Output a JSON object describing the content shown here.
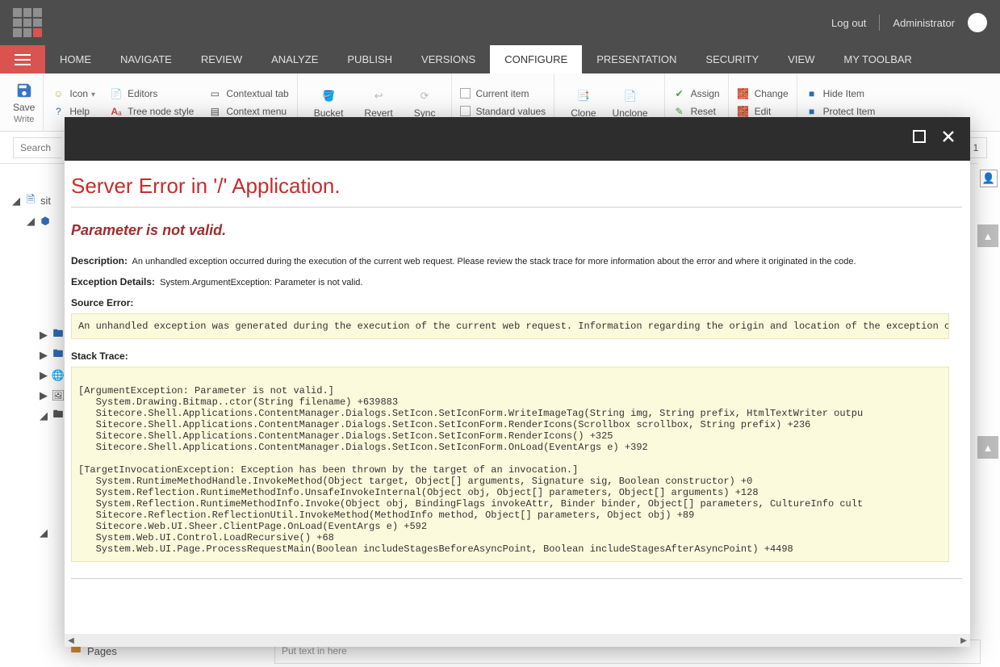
{
  "topbar": {
    "logout": "Log out",
    "user": "Administrator"
  },
  "nav": {
    "tabs": [
      "HOME",
      "NAVIGATE",
      "REVIEW",
      "ANALYZE",
      "PUBLISH",
      "VERSIONS",
      "CONFIGURE",
      "PRESENTATION",
      "SECURITY",
      "VIEW",
      "MY TOOLBAR"
    ],
    "active_index": 6
  },
  "ribbon": {
    "save": {
      "label": "Save",
      "sublabel": "Write"
    },
    "group1": {
      "icon_label": "Icon",
      "help": "Help",
      "editors": "Editors",
      "tree_node_style": "Tree node style",
      "contextual_tab": "Contextual tab",
      "context_menu": "Context menu"
    },
    "group2": {
      "bucket": "Bucket",
      "revert": "Revert",
      "sync": "Sync"
    },
    "group3": {
      "current_item": "Current item",
      "standard_values": "Standard values"
    },
    "group4": {
      "clone": "Clone",
      "unclone": "Unclone"
    },
    "group5": {
      "assign": "Assign",
      "reset": "Reset"
    },
    "group6": {
      "change": "Change",
      "edit": "Edit"
    },
    "group7": {
      "hide": "Hide Item",
      "protect": "Protect Item"
    }
  },
  "search": {
    "placeholder": "Search",
    "counter": "1"
  },
  "tree": {
    "root": "sit",
    "pages": "Pages"
  },
  "bottom": {
    "input_placeholder": "Put text in here"
  },
  "error": {
    "title": "Server Error in '/' Application.",
    "subtitle": "Parameter is not valid.",
    "description_label": "Description:",
    "description_text": "An unhandled exception occurred during the execution of the current web request. Please review the stack trace for more information about the error and where it originated in the code.",
    "exception_label": "Exception Details:",
    "exception_text": "System.ArgumentException: Parameter is not valid.",
    "source_error_label": "Source Error:",
    "source_error_text": "An unhandled exception was generated during the execution of the current web request. Information regarding the origin and location of the exception can be identified using the exception stack trace below.",
    "stack_trace_label": "Stack Trace:",
    "stack_trace_text": "\n[ArgumentException: Parameter is not valid.]\n   System.Drawing.Bitmap..ctor(String filename) +639883\n   Sitecore.Shell.Applications.ContentManager.Dialogs.SetIcon.SetIconForm.WriteImageTag(String img, String prefix, HtmlTextWriter outpu\n   Sitecore.Shell.Applications.ContentManager.Dialogs.SetIcon.SetIconForm.RenderIcons(Scrollbox scrollbox, String prefix) +236\n   Sitecore.Shell.Applications.ContentManager.Dialogs.SetIcon.SetIconForm.RenderIcons() +325\n   Sitecore.Shell.Applications.ContentManager.Dialogs.SetIcon.SetIconForm.OnLoad(EventArgs e) +392\n\n[TargetInvocationException: Exception has been thrown by the target of an invocation.]\n   System.RuntimeMethodHandle.InvokeMethod(Object target, Object[] arguments, Signature sig, Boolean constructor) +0\n   System.Reflection.RuntimeMethodInfo.UnsafeInvokeInternal(Object obj, Object[] parameters, Object[] arguments) +128\n   System.Reflection.RuntimeMethodInfo.Invoke(Object obj, BindingFlags invokeAttr, Binder binder, Object[] parameters, CultureInfo cult\n   Sitecore.Reflection.ReflectionUtil.InvokeMethod(MethodInfo method, Object[] parameters, Object obj) +89\n   Sitecore.Web.UI.Sheer.ClientPage.OnLoad(EventArgs e) +592\n   System.Web.UI.Control.LoadRecursive() +68\n   System.Web.UI.Page.ProcessRequestMain(Boolean includeStagesBeforeAsyncPoint, Boolean includeStagesAfterAsyncPoint) +4498\n"
  }
}
